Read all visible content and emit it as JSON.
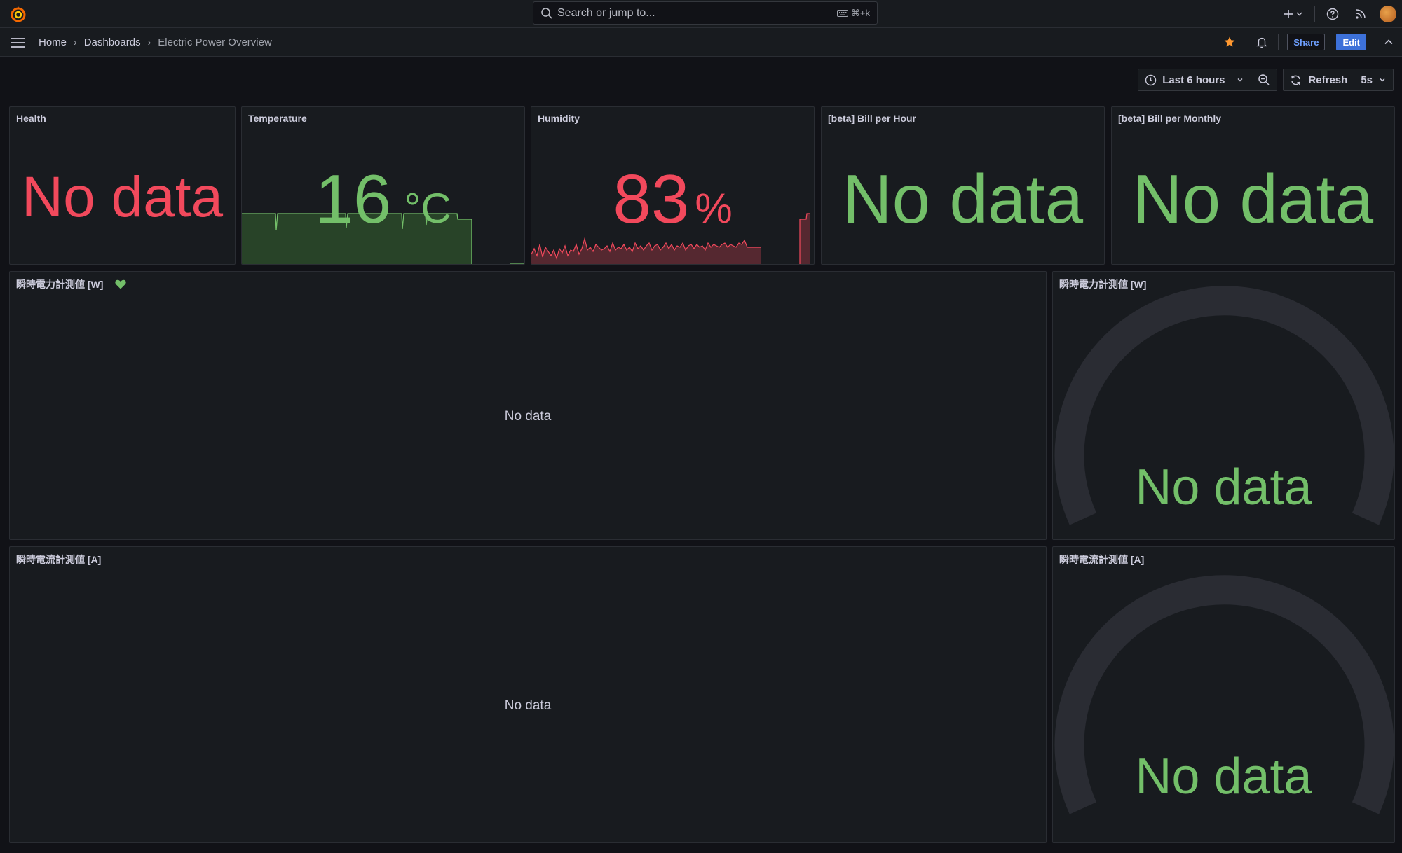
{
  "topbar": {
    "search_placeholder": "Search or jump to...",
    "shortcut": "⌘+k"
  },
  "breadcrumb": {
    "items": [
      "Home",
      "Dashboards"
    ],
    "current": "Electric Power Overview"
  },
  "nav": {
    "share_label": "Share",
    "edit_label": "Edit"
  },
  "time": {
    "range_label": "Last 6 hours",
    "refresh_label": "Refresh",
    "interval": "5s"
  },
  "panels": {
    "health": {
      "title": "Health",
      "value": "No data",
      "color": "#f2495c"
    },
    "temperature": {
      "title": "Temperature",
      "value": "16",
      "unit": "°C",
      "color": "#73bf69"
    },
    "humidity": {
      "title": "Humidity",
      "value": "83",
      "unit": "%",
      "color": "#f2495c"
    },
    "bill_hour": {
      "title": "[beta] Bill per Hour",
      "value": "No data",
      "color": "#73bf69"
    },
    "bill_monthly": {
      "title": "[beta] Bill per Monthly",
      "value": "No data",
      "color": "#73bf69"
    },
    "power_ts": {
      "title": "瞬時電力計測値 [W]",
      "message": "No data"
    },
    "power_gauge": {
      "title": "瞬時電力計測値 [W]",
      "value": "No data"
    },
    "current_ts": {
      "title": "瞬時電流計測値 [A]",
      "message": "No data"
    },
    "current_gauge": {
      "title": "瞬時電流計測値 [A]",
      "value": "No data"
    }
  },
  "icons": {
    "logo": "grafana-logo",
    "search": "search-icon",
    "star": "star-icon",
    "bell": "bell-icon",
    "health_heart": "heart-icon"
  }
}
